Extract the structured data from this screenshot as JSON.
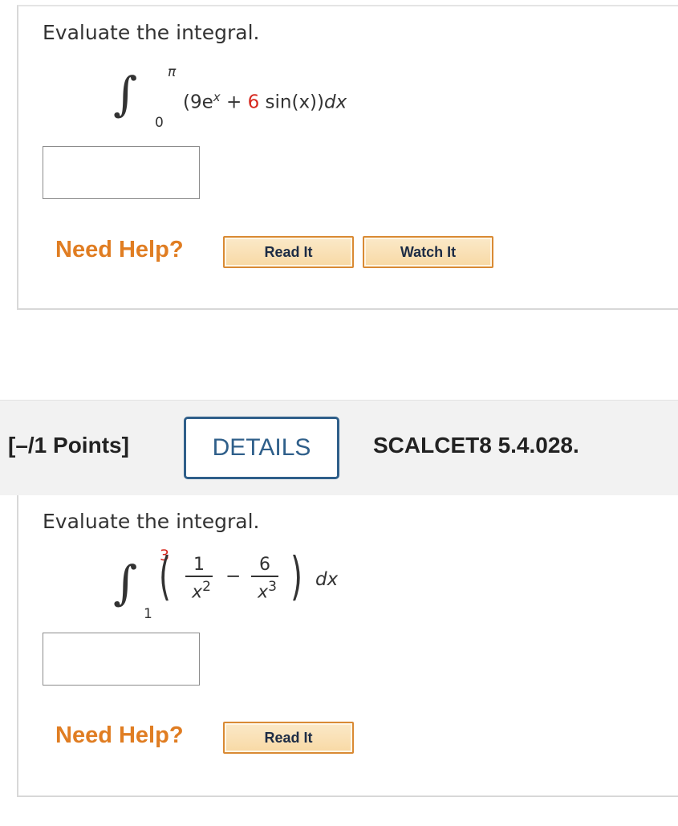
{
  "q1": {
    "prompt": "Evaluate the integral.",
    "upper": "π",
    "lower": "0",
    "integrand_open": "(9e",
    "exp": "x",
    "plus": " + ",
    "coef": "6",
    "integrand_rest": " sin(x))",
    "dx": "dx",
    "help_label": "Need Help?",
    "read_it": "Read It",
    "watch_it": "Watch It"
  },
  "header": {
    "points": "[–/1 Points]",
    "details": "DETAILS",
    "source": "SCALCET8 5.4.028."
  },
  "q2": {
    "prompt": "Evaluate the integral.",
    "upper": "3",
    "lower": "1",
    "num1": "1",
    "den1_base": "x",
    "den1_exp": "2",
    "minus": "−",
    "num2": "6",
    "den2_base": "x",
    "den2_exp": "3",
    "dx": "dx",
    "help_label": "Need Help?",
    "read_it": "Read It"
  },
  "colors": {
    "accent_orange": "#e07d22",
    "details_blue": "#2f5f8a",
    "red_value": "#d6281e"
  }
}
